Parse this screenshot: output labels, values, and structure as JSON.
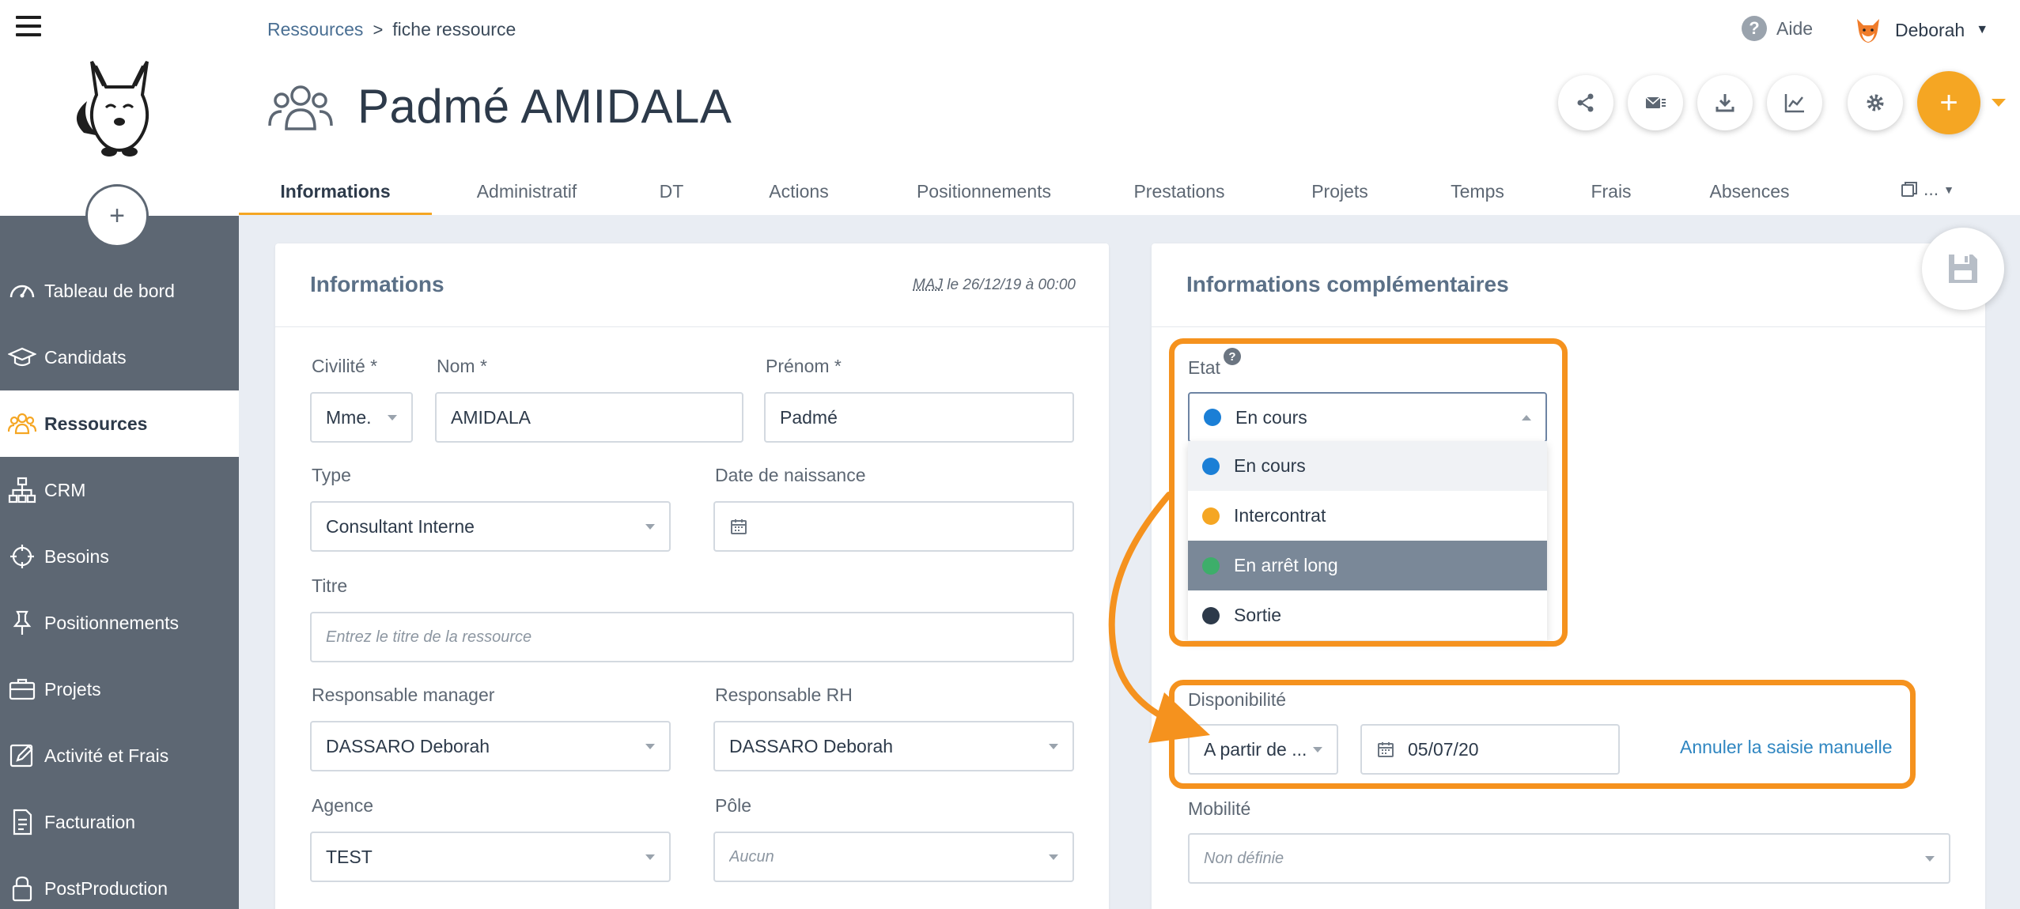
{
  "sidebar": {
    "add_label": "+",
    "items": [
      {
        "label": "Tableau de bord",
        "icon": "dashboard-icon"
      },
      {
        "label": "Candidats",
        "icon": "graduation-cap-icon"
      },
      {
        "label": "Ressources",
        "icon": "people-icon",
        "active": true
      },
      {
        "label": "CRM",
        "icon": "org-chart-icon"
      },
      {
        "label": "Besoins",
        "icon": "crosshair-icon"
      },
      {
        "label": "Positionnements",
        "icon": "pin-icon"
      },
      {
        "label": "Projets",
        "icon": "briefcase-icon"
      },
      {
        "label": "Activité et Frais",
        "icon": "edit-icon"
      },
      {
        "label": "Facturation",
        "icon": "invoice-icon"
      },
      {
        "label": "PostProduction",
        "icon": "lock-icon"
      }
    ]
  },
  "header": {
    "breadcrumb": {
      "parent": "Ressources",
      "separator": ">",
      "current": "fiche ressource"
    },
    "help_label": "Aide",
    "user_name": "Deborah",
    "page_title": "Padmé AMIDALA",
    "add_label": "+",
    "tabs": [
      "Informations",
      "Administratif",
      "DT",
      "Actions",
      "Positionnements",
      "Prestations",
      "Projets",
      "Temps",
      "Frais",
      "Absences"
    ],
    "tab_more": "..."
  },
  "informations": {
    "title": "Informations",
    "maj_prefix": "MAJ",
    "maj_text": " le 26/12/19 à 00:00",
    "civilite": {
      "label": "Civilité *",
      "value": "Mme."
    },
    "nom": {
      "label": "Nom *",
      "value": "AMIDALA"
    },
    "prenom": {
      "label": "Prénom *",
      "value": "Padmé"
    },
    "type": {
      "label": "Type",
      "value": "Consultant Interne"
    },
    "date_naissance": {
      "label": "Date de naissance",
      "value": ""
    },
    "titre": {
      "label": "Titre",
      "placeholder": "Entrez le titre de la ressource"
    },
    "resp_manager": {
      "label": "Responsable manager",
      "value": "DASSARO Deborah"
    },
    "resp_rh": {
      "label": "Responsable RH",
      "value": "DASSARO Deborah"
    },
    "agence": {
      "label": "Agence",
      "value": "TEST"
    },
    "pole": {
      "label": "Pôle",
      "value": "Aucun"
    }
  },
  "complementaires": {
    "title": "Informations complémentaires",
    "etat": {
      "label": "Etat",
      "help": "?",
      "value": "En cours",
      "value_color": "#1b7fd6",
      "options": [
        {
          "label": "En cours",
          "color": "#1b7fd6"
        },
        {
          "label": "Intercontrat",
          "color": "#f5a623"
        },
        {
          "label": "En arrêt long",
          "color": "#3dae6a"
        },
        {
          "label": "Sortie",
          "color": "#2d3a4a"
        }
      ]
    },
    "disponibilite": {
      "label": "Disponibilité",
      "mode": "A partir de ...",
      "date": "05/07/20",
      "reset_link": "Annuler la saisie manuelle"
    },
    "mobilite": {
      "label": "Mobilité",
      "value": "Non définie"
    }
  },
  "colors": {
    "accent": "#f5a623",
    "highlight": "#f5921e",
    "sidebar": "#5d6773"
  }
}
